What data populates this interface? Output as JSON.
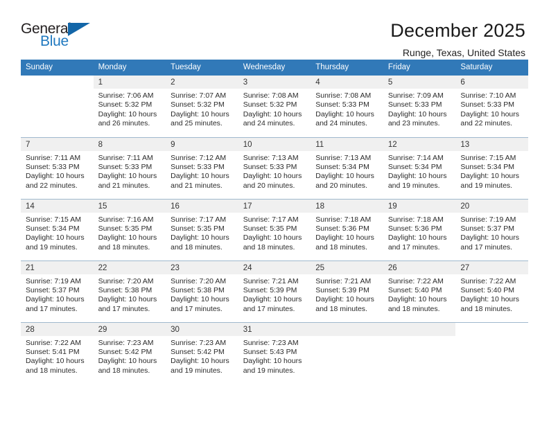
{
  "brand": {
    "logo_text_top": "General",
    "logo_text_bottom": "Blue",
    "logo_icon": "triangle-icon",
    "accent_color": "#1366a8",
    "header_color": "#3179b8"
  },
  "header": {
    "title": "December 2025",
    "subtitle": "Runge, Texas, United States"
  },
  "calendar": {
    "weekday_headers": [
      "Sunday",
      "Monday",
      "Tuesday",
      "Wednesday",
      "Thursday",
      "Friday",
      "Saturday"
    ],
    "labels": {
      "sunrise": "Sunrise:",
      "sunset": "Sunset:",
      "daylight": "Daylight:"
    },
    "weeks": [
      [
        {
          "day": "",
          "blank": true,
          "sunrise": "",
          "sunset": "",
          "daylight_line1": "",
          "daylight_line2": ""
        },
        {
          "day": "1",
          "sunrise": "Sunrise: 7:06 AM",
          "sunset": "Sunset: 5:32 PM",
          "daylight_line1": "Daylight: 10 hours",
          "daylight_line2": "and 26 minutes."
        },
        {
          "day": "2",
          "sunrise": "Sunrise: 7:07 AM",
          "sunset": "Sunset: 5:32 PM",
          "daylight_line1": "Daylight: 10 hours",
          "daylight_line2": "and 25 minutes."
        },
        {
          "day": "3",
          "sunrise": "Sunrise: 7:08 AM",
          "sunset": "Sunset: 5:32 PM",
          "daylight_line1": "Daylight: 10 hours",
          "daylight_line2": "and 24 minutes."
        },
        {
          "day": "4",
          "sunrise": "Sunrise: 7:08 AM",
          "sunset": "Sunset: 5:33 PM",
          "daylight_line1": "Daylight: 10 hours",
          "daylight_line2": "and 24 minutes."
        },
        {
          "day": "5",
          "sunrise": "Sunrise: 7:09 AM",
          "sunset": "Sunset: 5:33 PM",
          "daylight_line1": "Daylight: 10 hours",
          "daylight_line2": "and 23 minutes."
        },
        {
          "day": "6",
          "sunrise": "Sunrise: 7:10 AM",
          "sunset": "Sunset: 5:33 PM",
          "daylight_line1": "Daylight: 10 hours",
          "daylight_line2": "and 22 minutes."
        }
      ],
      [
        {
          "day": "7",
          "sunrise": "Sunrise: 7:11 AM",
          "sunset": "Sunset: 5:33 PM",
          "daylight_line1": "Daylight: 10 hours",
          "daylight_line2": "and 22 minutes."
        },
        {
          "day": "8",
          "sunrise": "Sunrise: 7:11 AM",
          "sunset": "Sunset: 5:33 PM",
          "daylight_line1": "Daylight: 10 hours",
          "daylight_line2": "and 21 minutes."
        },
        {
          "day": "9",
          "sunrise": "Sunrise: 7:12 AM",
          "sunset": "Sunset: 5:33 PM",
          "daylight_line1": "Daylight: 10 hours",
          "daylight_line2": "and 21 minutes."
        },
        {
          "day": "10",
          "sunrise": "Sunrise: 7:13 AM",
          "sunset": "Sunset: 5:33 PM",
          "daylight_line1": "Daylight: 10 hours",
          "daylight_line2": "and 20 minutes."
        },
        {
          "day": "11",
          "sunrise": "Sunrise: 7:13 AM",
          "sunset": "Sunset: 5:34 PM",
          "daylight_line1": "Daylight: 10 hours",
          "daylight_line2": "and 20 minutes."
        },
        {
          "day": "12",
          "sunrise": "Sunrise: 7:14 AM",
          "sunset": "Sunset: 5:34 PM",
          "daylight_line1": "Daylight: 10 hours",
          "daylight_line2": "and 19 minutes."
        },
        {
          "day": "13",
          "sunrise": "Sunrise: 7:15 AM",
          "sunset": "Sunset: 5:34 PM",
          "daylight_line1": "Daylight: 10 hours",
          "daylight_line2": "and 19 minutes."
        }
      ],
      [
        {
          "day": "14",
          "sunrise": "Sunrise: 7:15 AM",
          "sunset": "Sunset: 5:34 PM",
          "daylight_line1": "Daylight: 10 hours",
          "daylight_line2": "and 19 minutes."
        },
        {
          "day": "15",
          "sunrise": "Sunrise: 7:16 AM",
          "sunset": "Sunset: 5:35 PM",
          "daylight_line1": "Daylight: 10 hours",
          "daylight_line2": "and 18 minutes."
        },
        {
          "day": "16",
          "sunrise": "Sunrise: 7:17 AM",
          "sunset": "Sunset: 5:35 PM",
          "daylight_line1": "Daylight: 10 hours",
          "daylight_line2": "and 18 minutes."
        },
        {
          "day": "17",
          "sunrise": "Sunrise: 7:17 AM",
          "sunset": "Sunset: 5:35 PM",
          "daylight_line1": "Daylight: 10 hours",
          "daylight_line2": "and 18 minutes."
        },
        {
          "day": "18",
          "sunrise": "Sunrise: 7:18 AM",
          "sunset": "Sunset: 5:36 PM",
          "daylight_line1": "Daylight: 10 hours",
          "daylight_line2": "and 18 minutes."
        },
        {
          "day": "19",
          "sunrise": "Sunrise: 7:18 AM",
          "sunset": "Sunset: 5:36 PM",
          "daylight_line1": "Daylight: 10 hours",
          "daylight_line2": "and 17 minutes."
        },
        {
          "day": "20",
          "sunrise": "Sunrise: 7:19 AM",
          "sunset": "Sunset: 5:37 PM",
          "daylight_line1": "Daylight: 10 hours",
          "daylight_line2": "and 17 minutes."
        }
      ],
      [
        {
          "day": "21",
          "sunrise": "Sunrise: 7:19 AM",
          "sunset": "Sunset: 5:37 PM",
          "daylight_line1": "Daylight: 10 hours",
          "daylight_line2": "and 17 minutes."
        },
        {
          "day": "22",
          "sunrise": "Sunrise: 7:20 AM",
          "sunset": "Sunset: 5:38 PM",
          "daylight_line1": "Daylight: 10 hours",
          "daylight_line2": "and 17 minutes."
        },
        {
          "day": "23",
          "sunrise": "Sunrise: 7:20 AM",
          "sunset": "Sunset: 5:38 PM",
          "daylight_line1": "Daylight: 10 hours",
          "daylight_line2": "and 17 minutes."
        },
        {
          "day": "24",
          "sunrise": "Sunrise: 7:21 AM",
          "sunset": "Sunset: 5:39 PM",
          "daylight_line1": "Daylight: 10 hours",
          "daylight_line2": "and 17 minutes."
        },
        {
          "day": "25",
          "sunrise": "Sunrise: 7:21 AM",
          "sunset": "Sunset: 5:39 PM",
          "daylight_line1": "Daylight: 10 hours",
          "daylight_line2": "and 18 minutes."
        },
        {
          "day": "26",
          "sunrise": "Sunrise: 7:22 AM",
          "sunset": "Sunset: 5:40 PM",
          "daylight_line1": "Daylight: 10 hours",
          "daylight_line2": "and 18 minutes."
        },
        {
          "day": "27",
          "sunrise": "Sunrise: 7:22 AM",
          "sunset": "Sunset: 5:40 PM",
          "daylight_line1": "Daylight: 10 hours",
          "daylight_line2": "and 18 minutes."
        }
      ],
      [
        {
          "day": "28",
          "sunrise": "Sunrise: 7:22 AM",
          "sunset": "Sunset: 5:41 PM",
          "daylight_line1": "Daylight: 10 hours",
          "daylight_line2": "and 18 minutes."
        },
        {
          "day": "29",
          "sunrise": "Sunrise: 7:23 AM",
          "sunset": "Sunset: 5:42 PM",
          "daylight_line1": "Daylight: 10 hours",
          "daylight_line2": "and 18 minutes."
        },
        {
          "day": "30",
          "sunrise": "Sunrise: 7:23 AM",
          "sunset": "Sunset: 5:42 PM",
          "daylight_line1": "Daylight: 10 hours",
          "daylight_line2": "and 19 minutes."
        },
        {
          "day": "31",
          "sunrise": "Sunrise: 7:23 AM",
          "sunset": "Sunset: 5:43 PM",
          "daylight_line1": "Daylight: 10 hours",
          "daylight_line2": "and 19 minutes."
        },
        {
          "day": "",
          "empty": true,
          "sunrise": "",
          "sunset": "",
          "daylight_line1": "",
          "daylight_line2": ""
        },
        {
          "day": "",
          "empty": true,
          "sunrise": "",
          "sunset": "",
          "daylight_line1": "",
          "daylight_line2": ""
        },
        {
          "day": "",
          "blank": true,
          "sunrise": "",
          "sunset": "",
          "daylight_line1": "",
          "daylight_line2": ""
        }
      ]
    ]
  }
}
